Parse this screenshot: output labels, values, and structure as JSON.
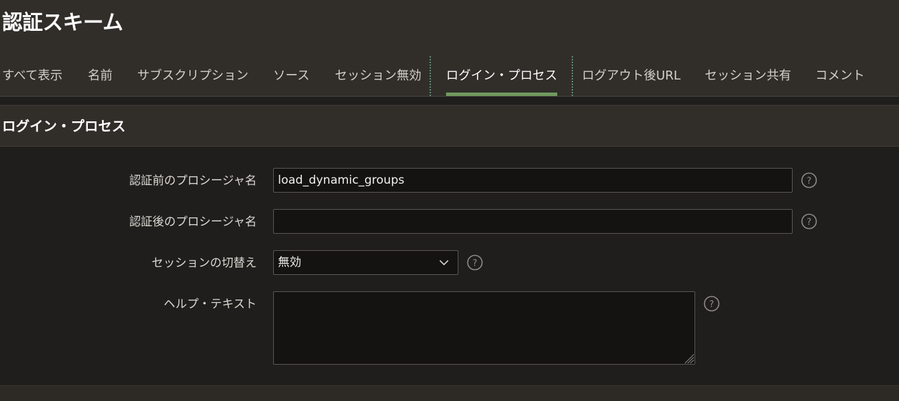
{
  "page": {
    "title": "認証スキーム"
  },
  "tabs": [
    {
      "label": "すべて表示",
      "active": false
    },
    {
      "label": "名前",
      "active": false
    },
    {
      "label": "サブスクリプション",
      "active": false
    },
    {
      "label": "ソース",
      "active": false
    },
    {
      "label": "セッション無効",
      "active": false
    },
    {
      "label": "ログイン・プロセス",
      "active": true
    },
    {
      "label": "ログアウト後URL",
      "active": false
    },
    {
      "label": "セッション共有",
      "active": false
    },
    {
      "label": "コメント",
      "active": false
    }
  ],
  "region": {
    "title": "ログイン・プロセス",
    "fields": {
      "pre_auth": {
        "label": "認証前のプロシージャ名",
        "value": "load_dynamic_groups",
        "help_icon": "help-circle-icon"
      },
      "post_auth": {
        "label": "認証後のプロシージャ名",
        "value": "",
        "help_icon": "help-circle-icon"
      },
      "session_switch": {
        "label": "セッションの切替え",
        "value": "無効",
        "icon": "chevron-down-icon",
        "help_icon": "help-circle-icon"
      },
      "help_text": {
        "label": "ヘルプ・テキスト",
        "value": "",
        "help_icon": "help-circle-icon"
      }
    }
  },
  "colors": {
    "accent_tab_underline": "#6f9a5e",
    "header_bg": "#312e2a",
    "body_bg": "#1f1e1c"
  }
}
